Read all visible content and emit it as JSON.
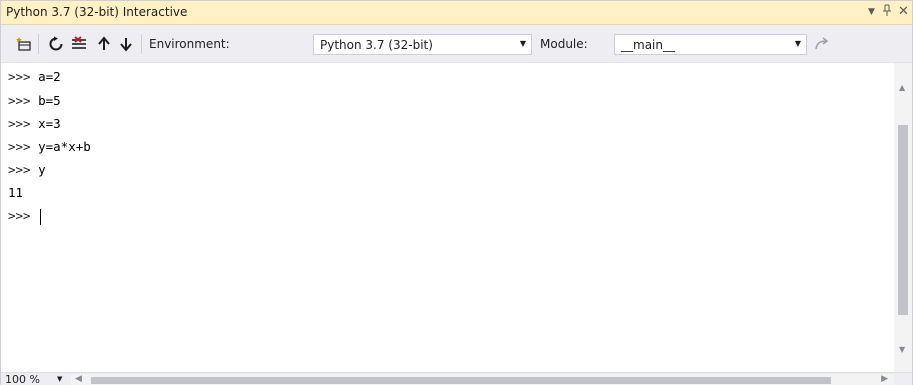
{
  "window": {
    "title": "Python 3.7 (32-bit) Interactive",
    "controls": {
      "menu": "▼",
      "pin": "ᵖ",
      "close": "✕"
    }
  },
  "toolbar": {
    "buttons": [
      {
        "name": "new-scope-icon",
        "glyph": "✱"
      },
      {
        "name": "reset-icon",
        "glyph": "↻"
      },
      {
        "name": "clear-icon",
        "glyph": "≡"
      },
      {
        "name": "history-up-icon",
        "glyph": "↑"
      },
      {
        "name": "history-down-icon",
        "glyph": "↓"
      }
    ],
    "environment_label": "Environment:",
    "environment_value": "Python 3.7 (32-bit)",
    "module_label": "Module:",
    "module_value": "__main__",
    "redo_icon": "↷"
  },
  "repl": {
    "lines": [
      {
        "prompt": ">>>",
        "code": "a=2"
      },
      {
        "prompt": ">>>",
        "code": "b=5"
      },
      {
        "prompt": ">>>",
        "code": "x=3"
      },
      {
        "prompt": ">>>",
        "code": "y=a*x+b"
      },
      {
        "prompt": ">>>",
        "code": "y"
      },
      {
        "prompt": "",
        "code": "11"
      },
      {
        "prompt": ">>>",
        "code": ""
      }
    ]
  },
  "status": {
    "zoom": "100 %"
  },
  "colors": {
    "title_bg": "#fff1c4",
    "toolbar_bg": "#eeeef2",
    "accent_blue": "#1e5fb4"
  }
}
